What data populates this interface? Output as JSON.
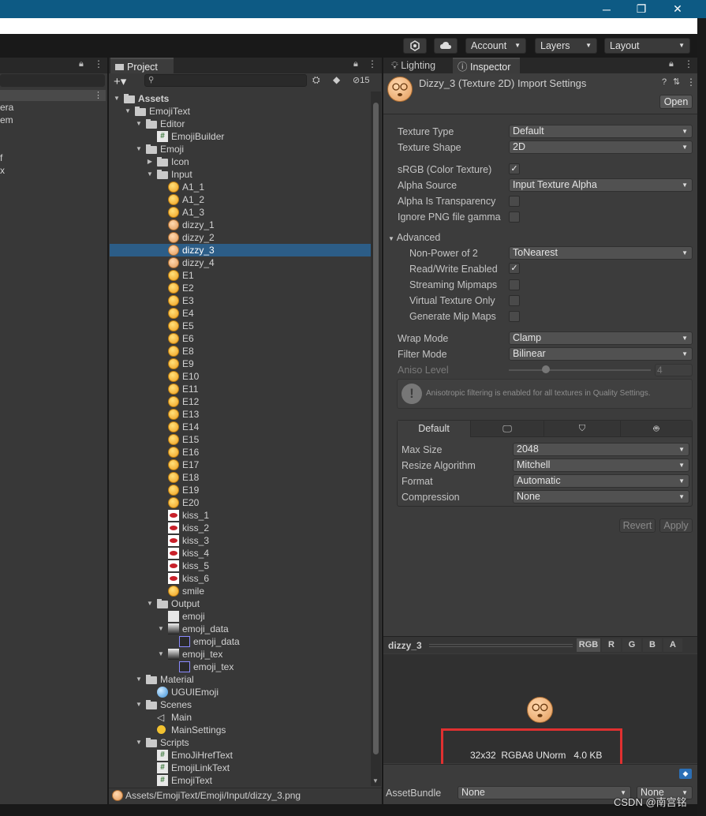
{
  "toolbar": {
    "account_label": "Account",
    "layers_label": "Layers",
    "layout_label": "Layout",
    "window_buttons": [
      "─",
      "❐",
      "✕"
    ]
  },
  "left_panel": {
    "partial_items": [
      "era",
      "em",
      "f",
      "x"
    ]
  },
  "project": {
    "tab_label": "Project",
    "hidden_count": "15",
    "tree": [
      {
        "label": "Assets",
        "indent": 0,
        "type": "folder",
        "expanded": true,
        "bold": true
      },
      {
        "label": "EmojiText",
        "indent": 1,
        "type": "folder",
        "expanded": true
      },
      {
        "label": "Editor",
        "indent": 2,
        "type": "folder",
        "expanded": true
      },
      {
        "label": "EmojiBuilder",
        "indent": 3,
        "type": "script"
      },
      {
        "label": "Emoji",
        "indent": 2,
        "type": "folder",
        "expanded": true
      },
      {
        "label": "Icon",
        "indent": 3,
        "type": "folder",
        "expanded": false
      },
      {
        "label": "Input",
        "indent": 3,
        "type": "folder",
        "expanded": true
      },
      {
        "label": "A1_1",
        "indent": 4,
        "type": "emoji"
      },
      {
        "label": "A1_2",
        "indent": 4,
        "type": "emoji"
      },
      {
        "label": "A1_3",
        "indent": 4,
        "type": "emoji"
      },
      {
        "label": "dizzy_1",
        "indent": 4,
        "type": "dizzy"
      },
      {
        "label": "dizzy_2",
        "indent": 4,
        "type": "dizzy"
      },
      {
        "label": "dizzy_3",
        "indent": 4,
        "type": "dizzy",
        "selected": true
      },
      {
        "label": "dizzy_4",
        "indent": 4,
        "type": "dizzy"
      },
      {
        "label": "E1",
        "indent": 4,
        "type": "emoji"
      },
      {
        "label": "E2",
        "indent": 4,
        "type": "emoji"
      },
      {
        "label": "E3",
        "indent": 4,
        "type": "emoji"
      },
      {
        "label": "E4",
        "indent": 4,
        "type": "emoji"
      },
      {
        "label": "E5",
        "indent": 4,
        "type": "emoji"
      },
      {
        "label": "E6",
        "indent": 4,
        "type": "emoji"
      },
      {
        "label": "E8",
        "indent": 4,
        "type": "emoji"
      },
      {
        "label": "E9",
        "indent": 4,
        "type": "emoji"
      },
      {
        "label": "E10",
        "indent": 4,
        "type": "emoji"
      },
      {
        "label": "E11",
        "indent": 4,
        "type": "emoji"
      },
      {
        "label": "E12",
        "indent": 4,
        "type": "emoji"
      },
      {
        "label": "E13",
        "indent": 4,
        "type": "emoji"
      },
      {
        "label": "E14",
        "indent": 4,
        "type": "emoji"
      },
      {
        "label": "E15",
        "indent": 4,
        "type": "emoji"
      },
      {
        "label": "E16",
        "indent": 4,
        "type": "emoji"
      },
      {
        "label": "E17",
        "indent": 4,
        "type": "emoji"
      },
      {
        "label": "E18",
        "indent": 4,
        "type": "emoji"
      },
      {
        "label": "E19",
        "indent": 4,
        "type": "emoji"
      },
      {
        "label": "E20",
        "indent": 4,
        "type": "emoji"
      },
      {
        "label": "kiss_1",
        "indent": 4,
        "type": "lips"
      },
      {
        "label": "kiss_2",
        "indent": 4,
        "type": "lips"
      },
      {
        "label": "kiss_3",
        "indent": 4,
        "type": "lips"
      },
      {
        "label": "kiss_4",
        "indent": 4,
        "type": "lips"
      },
      {
        "label": "kiss_5",
        "indent": 4,
        "type": "lips"
      },
      {
        "label": "kiss_6",
        "indent": 4,
        "type": "lips"
      },
      {
        "label": "smile",
        "indent": 4,
        "type": "emoji"
      },
      {
        "label": "Output",
        "indent": 3,
        "type": "folder",
        "expanded": true
      },
      {
        "label": "emoji",
        "indent": 4,
        "type": "doc"
      },
      {
        "label": "emoji_data",
        "indent": 4,
        "type": "tex",
        "expanded": true
      },
      {
        "label": "emoji_data",
        "indent": 5,
        "type": "sub"
      },
      {
        "label": "emoji_tex",
        "indent": 4,
        "type": "tex",
        "expanded": true
      },
      {
        "label": "emoji_tex",
        "indent": 5,
        "type": "sub"
      },
      {
        "label": "Material",
        "indent": 2,
        "type": "folder",
        "expanded": true
      },
      {
        "label": "UGUIEmoji",
        "indent": 3,
        "type": "sphere"
      },
      {
        "label": "Scenes",
        "indent": 2,
        "type": "folder",
        "expanded": true
      },
      {
        "label": "Main",
        "indent": 3,
        "type": "unity"
      },
      {
        "label": "MainSettings",
        "indent": 3,
        "type": "bulb"
      },
      {
        "label": "Scripts",
        "indent": 2,
        "type": "folder",
        "expanded": true
      },
      {
        "label": "EmoJiHrefText",
        "indent": 3,
        "type": "script"
      },
      {
        "label": "EmojiLinkText",
        "indent": 3,
        "type": "script"
      },
      {
        "label": "EmojiText",
        "indent": 3,
        "type": "script"
      }
    ],
    "status_path": "Assets/EmojiText/Emoji/Input/dizzy_3.png"
  },
  "inspector": {
    "tab_lighting": "Lighting",
    "tab_inspector": "Inspector",
    "title": "Dizzy_3 (Texture 2D) Import Settings",
    "open_button": "Open",
    "texture_type": {
      "label": "Texture Type",
      "value": "Default"
    },
    "texture_shape": {
      "label": "Texture Shape",
      "value": "2D"
    },
    "srgb": {
      "label": "sRGB (Color Texture)",
      "checked": true
    },
    "alpha_source": {
      "label": "Alpha Source",
      "value": "Input Texture Alpha"
    },
    "alpha_transparency": {
      "label": "Alpha Is Transparency",
      "checked": false
    },
    "ignore_png": {
      "label": "Ignore PNG file gamma",
      "checked": false
    },
    "advanced_label": "Advanced",
    "non_power_of_2": {
      "label": "Non-Power of 2",
      "value": "ToNearest"
    },
    "read_write": {
      "label": "Read/Write Enabled",
      "checked": true
    },
    "streaming_mipmaps": {
      "label": "Streaming Mipmaps",
      "checked": false
    },
    "virtual_texture": {
      "label": "Virtual Texture Only",
      "checked": false
    },
    "generate_mip": {
      "label": "Generate Mip Maps",
      "checked": false
    },
    "wrap_mode": {
      "label": "Wrap Mode",
      "value": "Clamp"
    },
    "filter_mode": {
      "label": "Filter Mode",
      "value": "Bilinear"
    },
    "aniso_level": {
      "label": "Aniso Level",
      "value": "4"
    },
    "aniso_info": "Anisotropic filtering is enabled for all textures in Quality Settings.",
    "platform_tab_default": "Default",
    "max_size": {
      "label": "Max Size",
      "value": "2048"
    },
    "resize_algorithm": {
      "label": "Resize Algorithm",
      "value": "Mitchell"
    },
    "format": {
      "label": "Format",
      "value": "Automatic"
    },
    "compression": {
      "label": "Compression",
      "value": "None"
    },
    "revert_button": "Revert",
    "apply_button": "Apply"
  },
  "preview": {
    "name": "dizzy_3",
    "channels": [
      "RGB",
      "R",
      "G",
      "B",
      "A"
    ],
    "info": "32x32  RGBA8 UNorm   4.0 KB",
    "highlight_color": "#e03030"
  },
  "assetbundle": {
    "label": "AssetBundle",
    "value": "None",
    "variant": "None"
  },
  "watermark": "CSDN @南宫铭"
}
